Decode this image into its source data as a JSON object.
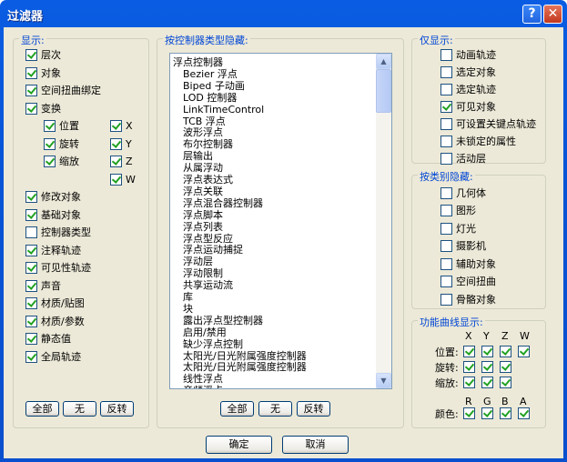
{
  "title": "过滤器",
  "titlebar": {
    "help": "?",
    "close": "✕"
  },
  "show": {
    "title": "显示:",
    "items": [
      "层次",
      "对象",
      "空间扭曲绑定",
      "变换"
    ],
    "items_checked": [
      true,
      true,
      true,
      true
    ],
    "transform": [
      "位置",
      "旋转",
      "缩放"
    ],
    "transform_checked": [
      true,
      true,
      true
    ],
    "axes": [
      "X",
      "Y",
      "Z",
      "W"
    ],
    "axes_checked": [
      true,
      true,
      true,
      true
    ],
    "items2": [
      "修改对象",
      "基础对象",
      "控制器类型",
      "注释轨迹",
      "可见性轨迹",
      "声音",
      "材质/贴图",
      "材质/参数",
      "静态值",
      "全局轨迹"
    ],
    "items2_checked": [
      true,
      true,
      false,
      true,
      true,
      true,
      true,
      true,
      true,
      true
    ],
    "buttons": [
      "全部",
      "无",
      "反转"
    ]
  },
  "hide_by_controller": {
    "title": "按控制器类型隐藏:",
    "items": [
      "浮点控制器",
      "Bezier 浮点",
      "Biped 子动画",
      "LOD 控制器",
      "LinkTimeControl",
      "TCB 浮点",
      "波形浮点",
      "布尔控制器",
      "层输出",
      "从属浮动",
      "浮点表达式",
      "浮点关联",
      "浮点混合器控制器",
      "浮点脚本",
      "浮点列表",
      "浮点型反应",
      "浮点运动捕捉",
      "浮动层",
      "浮动限制",
      "共享运动流",
      "库",
      "块",
      "露出浮点型控制器",
      "启用/禁用",
      "缺少浮点控制",
      "太阳光/日光附属强度控制器",
      "太阳光/日光附属强度控制器",
      "线性浮点",
      "音频浮点"
    ],
    "buttons": [
      "全部",
      "无",
      "反转"
    ]
  },
  "only_show": {
    "title": "仅显示:",
    "items": [
      "动画轨迹",
      "选定对象",
      "选定轨迹",
      "可见对象",
      "可设置关键点轨迹",
      "未锁定的属性",
      "活动层"
    ],
    "checked": [
      false,
      false,
      false,
      true,
      false,
      false,
      false
    ]
  },
  "hide_by_category": {
    "title": "按类别隐藏:",
    "items": [
      "几何体",
      "图形",
      "灯光",
      "摄影机",
      "辅助对象",
      "空间扭曲",
      "骨骼对象"
    ],
    "checked": [
      false,
      false,
      false,
      false,
      false,
      false,
      false
    ]
  },
  "curve_display": {
    "title": "功能曲线显示:",
    "axes": [
      "X",
      "Y",
      "Z",
      "W"
    ],
    "rows": [
      "位置:",
      "旋转:",
      "缩放:"
    ],
    "rows_checked": [
      [
        true,
        true,
        true,
        true
      ],
      [
        true,
        true,
        true,
        false
      ],
      [
        true,
        true,
        true,
        false
      ]
    ],
    "color_channels": [
      "R",
      "G",
      "B",
      "A"
    ],
    "color_label": "颜色:",
    "color_checked": [
      true,
      true,
      true,
      true
    ]
  },
  "footer": {
    "ok": "确定",
    "cancel": "取消"
  },
  "colors": {
    "title_bar": "#0a5ce2",
    "panel": "#ece9d8",
    "group_title": "#0046d5",
    "check": "#21a121"
  }
}
